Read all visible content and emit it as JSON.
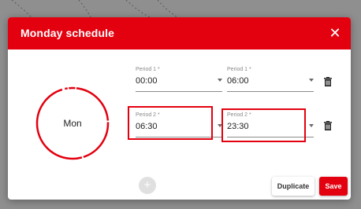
{
  "dialog": {
    "title": "Monday schedule",
    "close_icon": "close-icon"
  },
  "day_circle": {
    "label": "Mon"
  },
  "periods": [
    {
      "start_label": "Period 1 *",
      "start_value": "00:00",
      "end_label": "Period 1 *",
      "end_value": "06:00",
      "delete_icon": "trash-icon"
    },
    {
      "start_label": "Period 2 *",
      "start_value": "06:30",
      "end_label": "Period 2 *",
      "end_value": "23:30",
      "delete_icon": "trash-icon"
    }
  ],
  "actions": {
    "add_label": "+",
    "duplicate_label": "Duplicate",
    "save_label": "Save"
  },
  "colors": {
    "accent": "#e3000f",
    "backdrop": "#8f8f8f"
  }
}
